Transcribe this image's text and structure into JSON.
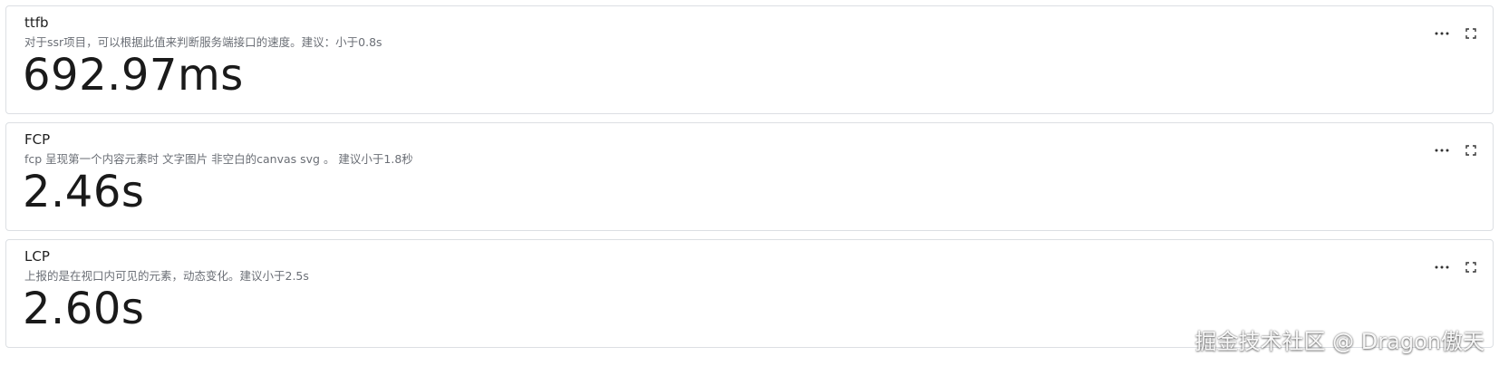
{
  "panels": [
    {
      "title": "ttfb",
      "description": "对于ssr项目，可以根据此值来判断服务端接口的速度。建议：小于0.8s",
      "value": "692.97ms",
      "menu_icon": "more-horizontal-icon",
      "expand_icon": "fullscreen-icon"
    },
    {
      "title": "FCP",
      "description": "fcp 呈现第一个内容元素时 文字图片 非空白的canvas svg 。 建议小于1.8秒",
      "value": "2.46s",
      "menu_icon": "more-horizontal-icon",
      "expand_icon": "fullscreen-icon"
    },
    {
      "title": "LCP",
      "description": "上报的是在视口内可见的元素，动态变化。建议小于2.5s",
      "value": "2.60s",
      "menu_icon": "more-horizontal-icon",
      "expand_icon": "fullscreen-icon"
    }
  ],
  "watermark": "掘金技术社区 @ Dragon傲天"
}
